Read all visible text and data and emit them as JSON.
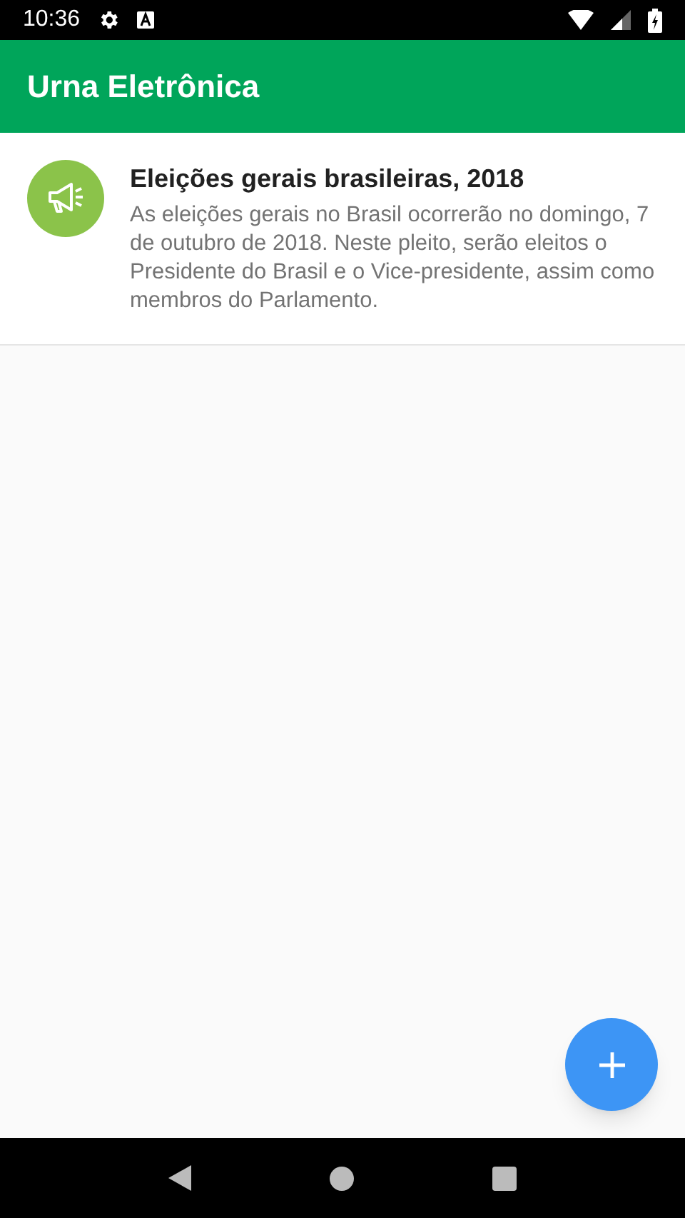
{
  "status_bar": {
    "time": "10:36"
  },
  "app_bar": {
    "title": "Urna Eletrônica"
  },
  "items": [
    {
      "title": "Eleições gerais brasileiras, 2018",
      "description": "As eleições gerais no Brasil ocorrerão no domingo, 7 de outubro de 2018. Neste pleito, serão eleitos o Presidente do Brasil e o Vice-presidente, assim como membros do Parlamento.",
      "color": "#8bc34a"
    }
  ]
}
